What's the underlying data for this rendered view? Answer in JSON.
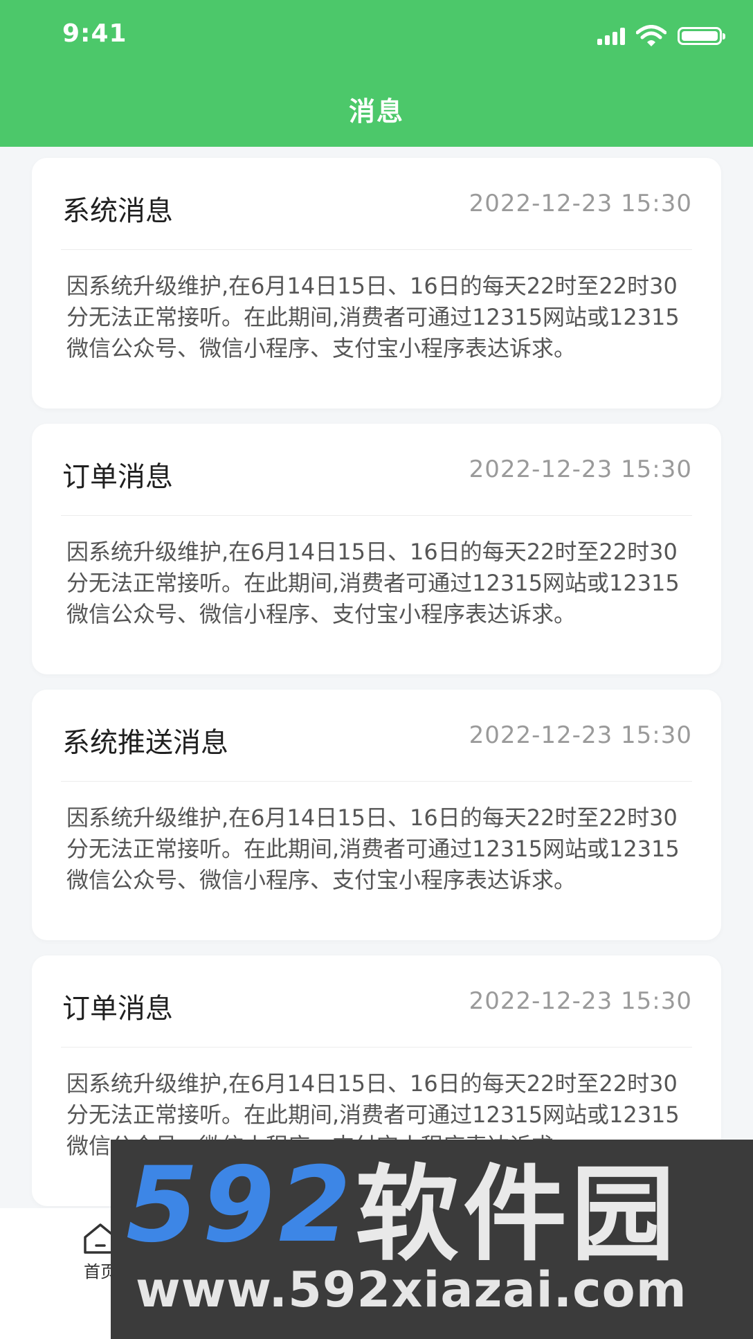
{
  "status_bar": {
    "time": "9:41"
  },
  "header": {
    "title": "消息",
    "bg_color": "#4cc86a"
  },
  "messages": [
    {
      "title": "系统消息",
      "datetime": "2022-12-23   15:30",
      "body": "因系统升级维护,在6月14日15日、16日的每天22时至22时30分无法正常接听。在此期间,消费者可通过12315网站或12315微信公众号、微信小程序、支付宝小程序表达诉求。"
    },
    {
      "title": "订单消息",
      "datetime": "2022-12-23   15:30",
      "body": "因系统升级维护,在6月14日15日、16日的每天22时至22时30分无法正常接听。在此期间,消费者可通过12315网站或12315微信公众号、微信小程序、支付宝小程序表达诉求。"
    },
    {
      "title": "系统推送消息",
      "datetime": "2022-12-23   15:30",
      "body": "因系统升级维护,在6月14日15日、16日的每天22时至22时30分无法正常接听。在此期间,消费者可通过12315网站或12315微信公众号、微信小程序、支付宝小程序表达诉求。"
    },
    {
      "title": "订单消息",
      "datetime": "2022-12-23   15:30",
      "body": "因系统升级维护,在6月14日15日、16日的每天22时至22时30分无法正常接听。在此期间,消费者可通过12315网站或12315微信公众号、微信小程序、支付宝小程序表达诉求。"
    }
  ],
  "tabbar": {
    "home_label": "首页",
    "home_icon": "home-icon"
  },
  "watermark": {
    "logo_number": "592",
    "logo_text": "软件园",
    "url": "www.592xiazai.com"
  }
}
